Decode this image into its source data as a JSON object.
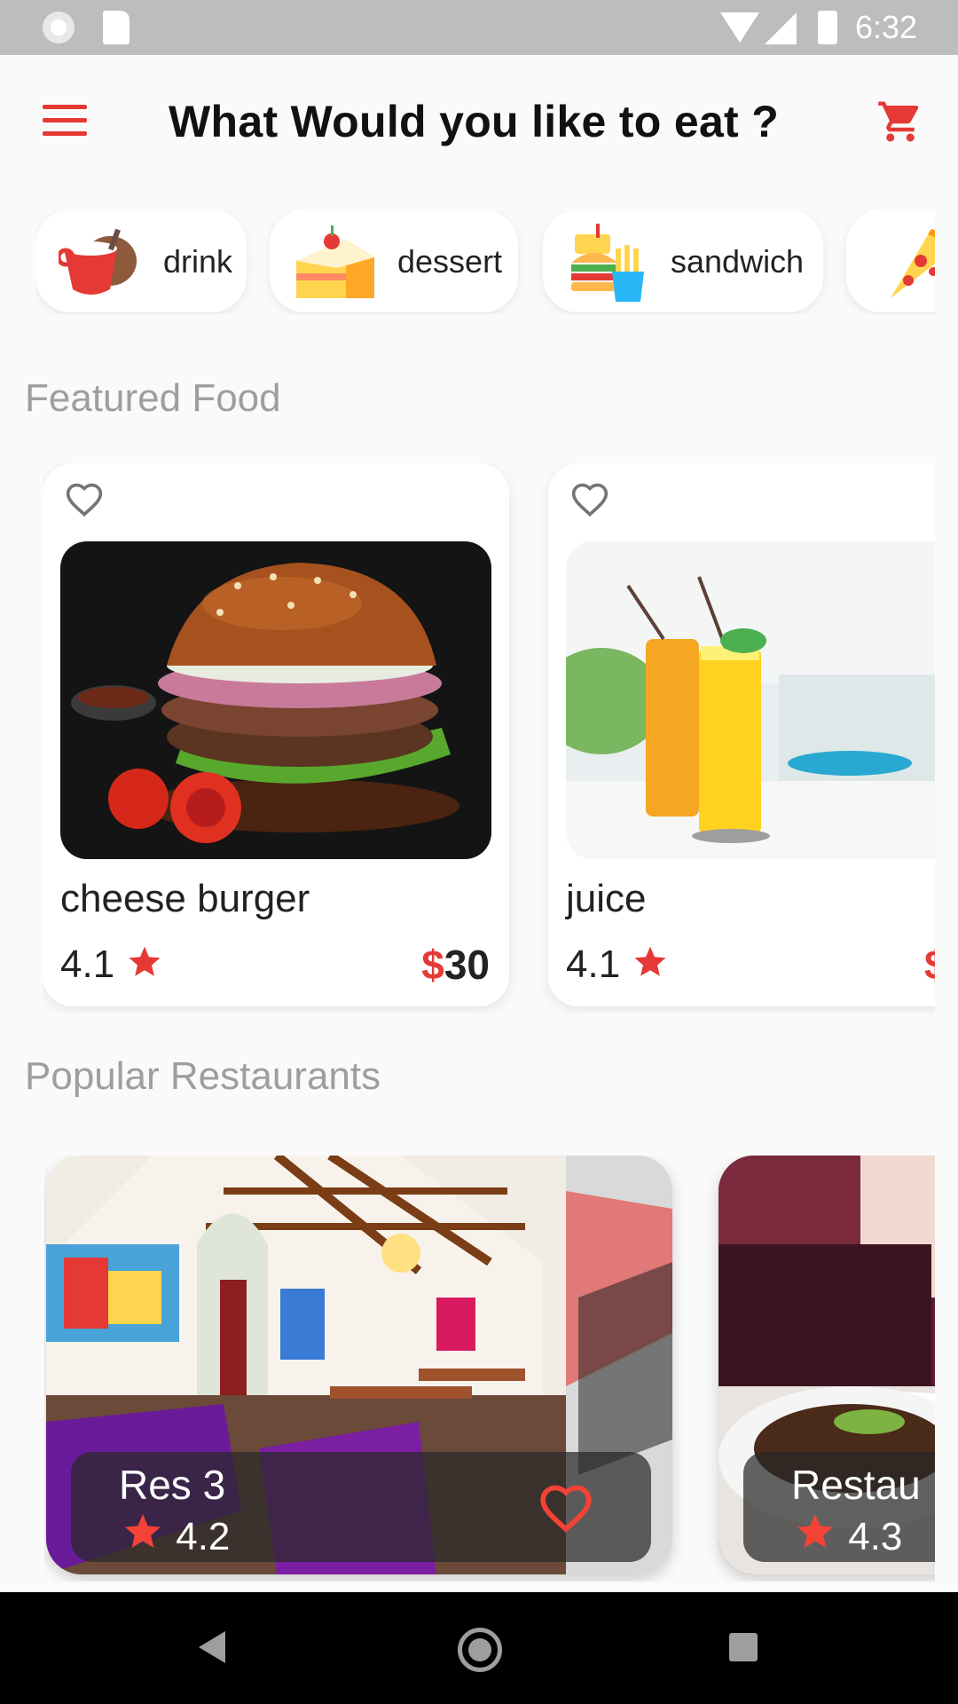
{
  "status_bar": {
    "time": "6:32"
  },
  "header": {
    "title": "What Would you like to eat ?",
    "menu_icon": "hamburger-menu-icon",
    "cart_icon": "shopping-cart-icon"
  },
  "colors": {
    "accent": "#e53935",
    "section_text": "#9e9e9e",
    "background": "#fafafa"
  },
  "categories": [
    {
      "label": "drink",
      "icon": "drink-icon"
    },
    {
      "label": "dessert",
      "icon": "cake-icon"
    },
    {
      "label": "sandwich",
      "icon": "burger-fries-icon"
    },
    {
      "label": "",
      "icon": "pizza-icon"
    }
  ],
  "featured": {
    "title": "Featured Food",
    "items": [
      {
        "name": "cheese burger",
        "rating": "4.1",
        "currency": "$",
        "price": "30",
        "image": "cheese-burger-photo"
      },
      {
        "name": "juice",
        "rating": "4.1",
        "currency": "$",
        "price": "",
        "image": "juice-glasses-photo"
      }
    ]
  },
  "restaurants": {
    "title": "Popular Restaurants",
    "items": [
      {
        "name": "Res 3",
        "rating": "4.2",
        "image": "restaurant-interior-photo"
      },
      {
        "name": "Restau",
        "rating": "4.3",
        "image": "restaurant-dish-photo"
      }
    ]
  },
  "nav": {
    "back_icon": "back-triangle-icon",
    "home_icon": "home-circle-icon",
    "recent_icon": "recent-apps-square-icon"
  }
}
